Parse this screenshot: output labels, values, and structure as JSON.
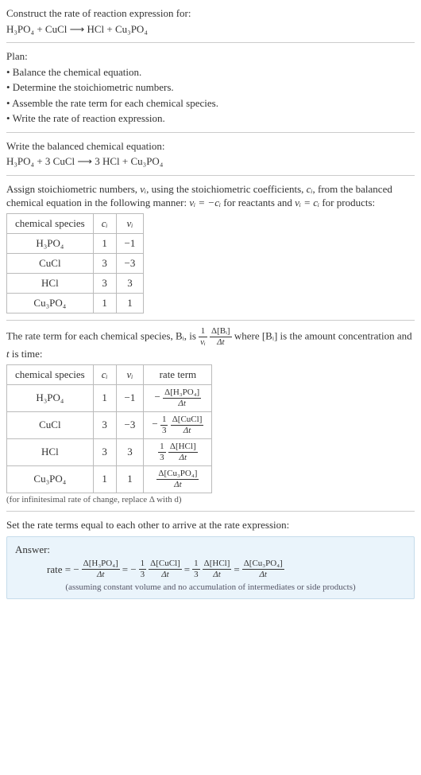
{
  "intro": {
    "title": "Construct the rate of reaction expression for:",
    "equation": "H₃PO₄ + CuCl ⟶ HCl + Cu₃PO₄"
  },
  "plan": {
    "heading": "Plan:",
    "b1": "• Balance the chemical equation.",
    "b2": "• Determine the stoichiometric numbers.",
    "b3": "• Assemble the rate term for each chemical species.",
    "b4": "• Write the rate of reaction expression."
  },
  "balanced": {
    "heading": "Write the balanced chemical equation:",
    "equation": "H₃PO₄ + 3 CuCl ⟶ 3 HCl + Cu₃PO₄"
  },
  "assign": {
    "text_a": "Assign stoichiometric numbers, ",
    "nu_i": "νᵢ",
    "text_b": ", using the stoichiometric coefficients, ",
    "c_i": "cᵢ",
    "text_c": ", from the balanced chemical equation in the following manner: ",
    "rel_react": "νᵢ = −cᵢ",
    "text_d": " for reactants and ",
    "rel_prod": "νᵢ = cᵢ",
    "text_e": " for products:"
  },
  "table1": {
    "h1": "chemical species",
    "h2": "cᵢ",
    "h3": "νᵢ",
    "rows": [
      {
        "sp": "H₃PO₄",
        "c": "1",
        "v": "−1"
      },
      {
        "sp": "CuCl",
        "c": "3",
        "v": "−3"
      },
      {
        "sp": "HCl",
        "c": "3",
        "v": "3"
      },
      {
        "sp": "Cu₃PO₄",
        "c": "1",
        "v": "1"
      }
    ]
  },
  "rateterm": {
    "pre": "The rate term for each chemical species, Bᵢ, is ",
    "frac1_num": "1",
    "frac1_den": "νᵢ",
    "frac2_num": "Δ[Bᵢ]",
    "frac2_den": "Δt",
    "post_a": " where [Bᵢ] is the amount concentration and ",
    "t": "t",
    "post_b": " is time:"
  },
  "table2": {
    "h1": "chemical species",
    "h2": "cᵢ",
    "h3": "νᵢ",
    "h4": "rate term",
    "rows": [
      {
        "sp": "H₃PO₄",
        "c": "1",
        "v": "−1",
        "pre": "−",
        "num": "Δ[H₃PO₄]",
        "den": "Δt"
      },
      {
        "sp": "CuCl",
        "c": "3",
        "v": "−3",
        "pre": "−",
        "coef_num": "1",
        "coef_den": "3",
        "num": "Δ[CuCl]",
        "den": "Δt"
      },
      {
        "sp": "HCl",
        "c": "3",
        "v": "3",
        "pre": "",
        "coef_num": "1",
        "coef_den": "3",
        "num": "Δ[HCl]",
        "den": "Δt"
      },
      {
        "sp": "Cu₃PO₄",
        "c": "1",
        "v": "1",
        "pre": "",
        "num": "Δ[Cu₃PO₄]",
        "den": "Δt"
      }
    ],
    "foot": "(for infinitesimal rate of change, replace Δ with d)"
  },
  "setequal": "Set the rate terms equal to each other to arrive at the rate expression:",
  "answer": {
    "heading": "Answer:",
    "lead": "rate = −",
    "t1_num": "Δ[H₃PO₄]",
    "t1_den": "Δt",
    "eq1": " = −",
    "c2_num": "1",
    "c2_den": "3",
    "t2_num": "Δ[CuCl]",
    "t2_den": "Δt",
    "eq2": " = ",
    "c3_num": "1",
    "c3_den": "3",
    "t3_num": "Δ[HCl]",
    "t3_den": "Δt",
    "eq3": " = ",
    "t4_num": "Δ[Cu₃PO₄]",
    "t4_den": "Δt",
    "note": "(assuming constant volume and no accumulation of intermediates or side products)"
  }
}
